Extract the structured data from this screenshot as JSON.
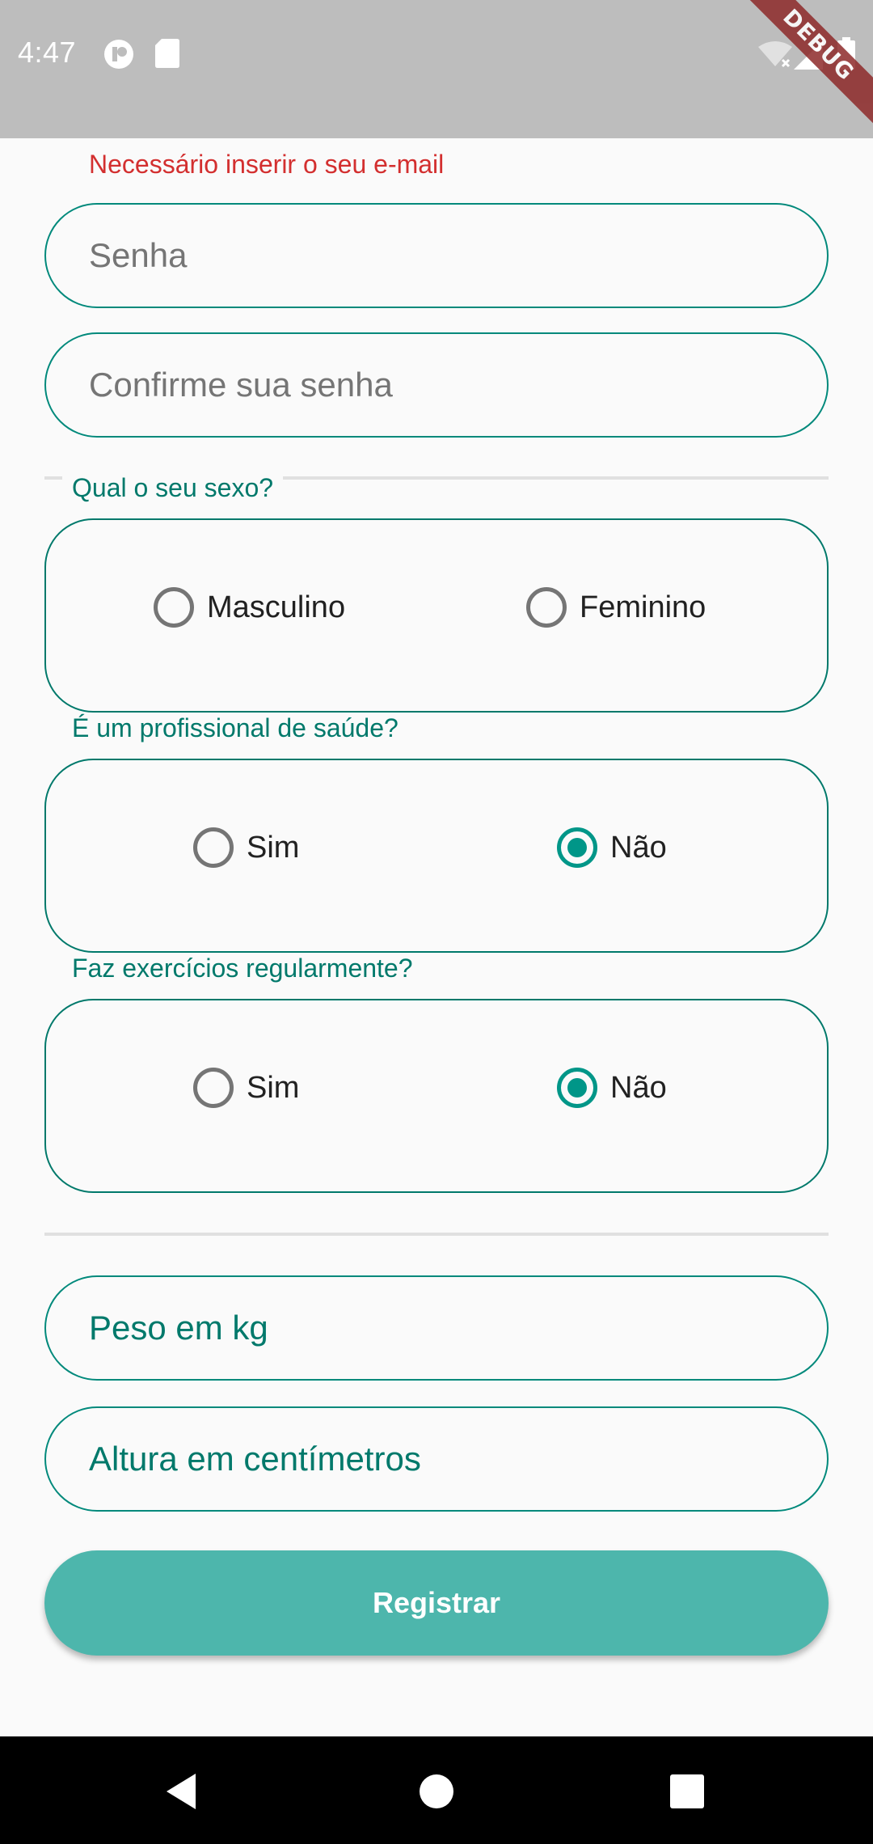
{
  "status_bar": {
    "time": "4:47",
    "debug_label": "DEBUG",
    "icons": [
      "notification-app-icon",
      "sd-card-icon",
      "wifi-off-icon",
      "signal-icon",
      "battery-icon"
    ]
  },
  "form": {
    "email_error": "Necessário inserir o seu e-mail",
    "password_placeholder": "Senha",
    "confirm_password_placeholder": "Confirme sua senha",
    "sex_group": {
      "label": "Qual o seu sexo?",
      "options": [
        "Masculino",
        "Feminino"
      ],
      "selected": ""
    },
    "health_professional_group": {
      "label": "É um profissional de saúde?",
      "options": [
        "Sim",
        "Não"
      ],
      "selected": "Não"
    },
    "exercise_group": {
      "label": "Faz exercícios regularmente?",
      "options": [
        "Sim",
        "Não"
      ],
      "selected": "Não"
    },
    "weight_placeholder": "Peso em kg",
    "height_placeholder": "Altura em centímetros",
    "register_label": "Registrar"
  },
  "colors": {
    "accent": "#009688",
    "border": "#00897b",
    "button": "#4db6ac",
    "error": "#d32f2f"
  },
  "nav_bar": {
    "icons": [
      "back-icon",
      "home-icon",
      "recents-icon"
    ]
  }
}
